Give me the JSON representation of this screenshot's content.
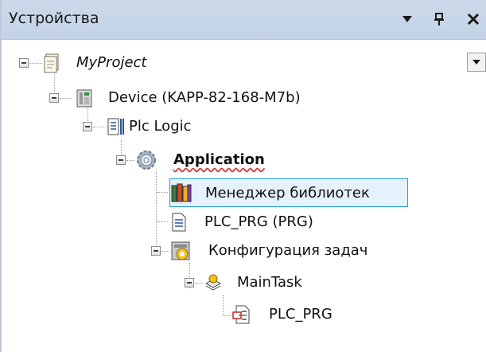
{
  "panel": {
    "title": "Устройства",
    "buttons": {
      "dropdown_icon": "triangle-down",
      "pin_icon": "pin",
      "close_icon": "close"
    }
  },
  "tree": {
    "project": "MyProject",
    "device": "Device (KAPP-82-168-M7b)",
    "plc_logic": "Plc Logic",
    "application": "Application",
    "library_manager": "Менеджер библиотек",
    "plc_prg_pou": "PLC_PRG (PRG)",
    "task_config": "Конфигурация задач",
    "main_task": "MainTask",
    "plc_prg_call": "PLC_PRG"
  },
  "colors": {
    "titlebar": "#c3d3e6",
    "selection_border": "#26a0da",
    "selection_fill": "#e5f1fb"
  }
}
